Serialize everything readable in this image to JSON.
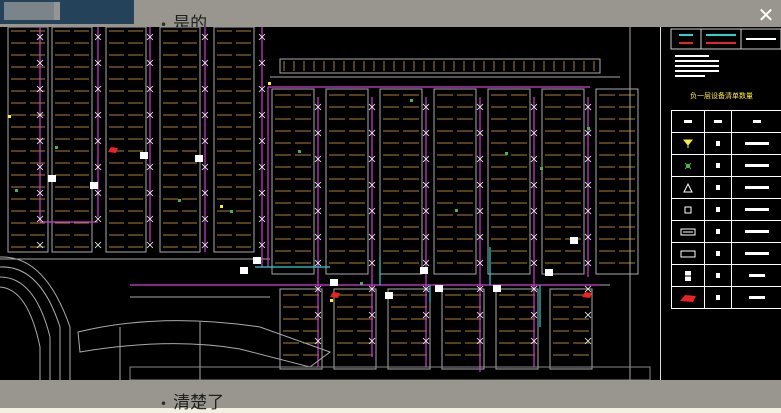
{
  "background_page": {
    "line1_text": "是的",
    "line2_text": "清楚了",
    "bullet": "•"
  },
  "viewer": {
    "close_label": "✕"
  },
  "legend": {
    "title": "负一层设备清单数量",
    "rows": 8
  },
  "colors": {
    "drawing_bg": "#000000",
    "wall": "#b5b5b5",
    "parking": "#d2a04a",
    "pipe_magenta": "#d23cd2",
    "pipe_cyan": "#2ad1d1",
    "legend_title": "#ffeb3b",
    "accent_red": "#e82323"
  }
}
